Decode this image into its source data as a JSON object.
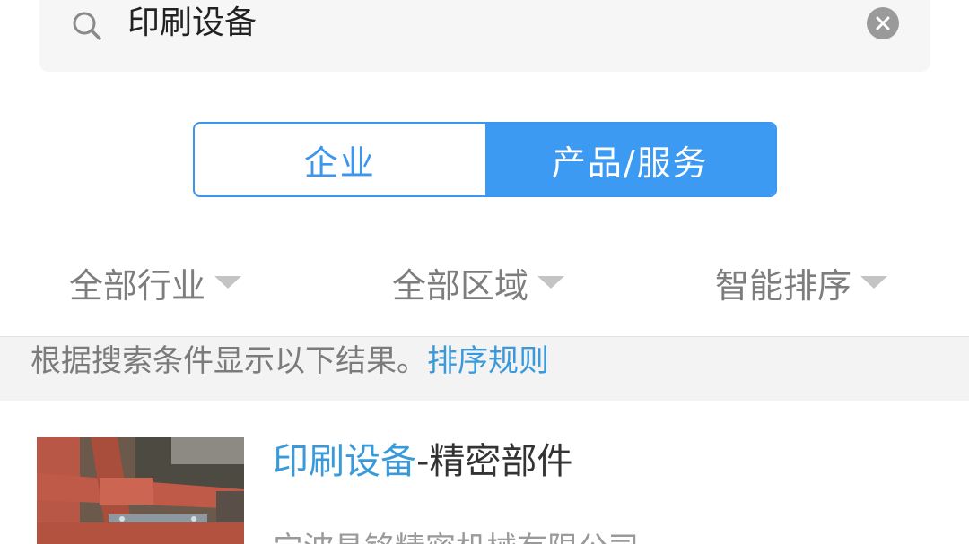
{
  "search": {
    "query": "印刷设备"
  },
  "segment": {
    "tabs": [
      {
        "label": "企业",
        "active": false
      },
      {
        "label": "产品/服务",
        "active": true
      }
    ]
  },
  "filters": [
    {
      "label": "全部行业"
    },
    {
      "label": "全部区域"
    },
    {
      "label": "智能排序"
    }
  ],
  "info": {
    "text": "根据搜索条件显示以下结果。",
    "link": "排序规则"
  },
  "results": [
    {
      "title_highlight": "印刷设备",
      "title_rest": "-精密部件",
      "company": "宁波昌铭精密机械有限公司"
    }
  ],
  "colors": {
    "accent": "#3c9af3",
    "link": "#3a9ad9"
  }
}
